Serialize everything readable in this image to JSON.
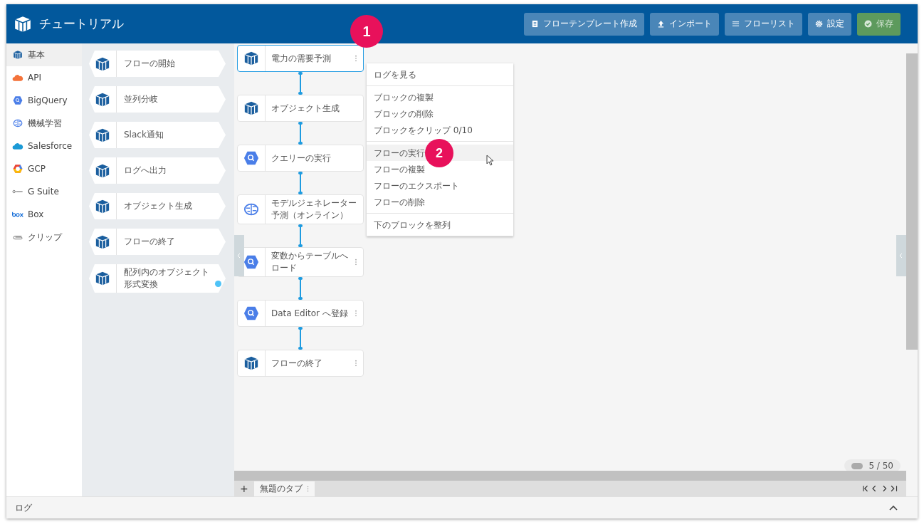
{
  "header": {
    "title": "チュートリアル",
    "buttons": [
      {
        "label": "フローテンプレート作成",
        "kind": "template"
      },
      {
        "label": "インポート",
        "kind": "import"
      },
      {
        "label": "フローリスト",
        "kind": "list"
      },
      {
        "label": "設定",
        "kind": "settings"
      },
      {
        "label": "保存",
        "kind": "save"
      }
    ]
  },
  "categories": [
    {
      "label": "基本",
      "kind": "logo",
      "selected": true
    },
    {
      "label": "API",
      "kind": "api",
      "selected": false
    },
    {
      "label": "BigQuery",
      "kind": "bigquery",
      "selected": false
    },
    {
      "label": "機械学習",
      "kind": "ml",
      "selected": false
    },
    {
      "label": "Salesforce",
      "kind": "cloud",
      "selected": false
    },
    {
      "label": "GCP",
      "kind": "gcp",
      "selected": false
    },
    {
      "label": "G Suite",
      "kind": "gsuite",
      "selected": false
    },
    {
      "label": "Box",
      "kind": "box",
      "selected": false
    },
    {
      "label": "クリップ",
      "kind": "clip",
      "selected": false
    }
  ],
  "palette": [
    {
      "label": "フローの開始",
      "kind": "logo",
      "note": false
    },
    {
      "label": "並列分岐",
      "kind": "logo",
      "note": false
    },
    {
      "label": "Slack通知",
      "kind": "logo",
      "note": false
    },
    {
      "label": "ログへ出力",
      "kind": "logo",
      "note": false
    },
    {
      "label": "オブジェクト生成",
      "kind": "logo",
      "note": false
    },
    {
      "label": "フローの終了",
      "kind": "logo",
      "note": false
    },
    {
      "label": "配列内のオブジェクト形式変換",
      "kind": "logo",
      "note": true
    }
  ],
  "flow": [
    {
      "label": "電力の需要予測",
      "kind": "logo",
      "selected": true,
      "menu_button": true
    },
    {
      "label": "オブジェクト生成",
      "kind": "logo",
      "selected": false,
      "menu_button": false
    },
    {
      "label": "クエリーの実行",
      "kind": "bigquery",
      "selected": false,
      "menu_button": false
    },
    {
      "label": "モデルジェネレーター予測（オンライン）",
      "kind": "ml",
      "selected": false,
      "menu_button": false
    },
    {
      "label": "変数からテーブルへロード",
      "kind": "bigquery",
      "selected": false,
      "menu_button": true
    },
    {
      "label": "Data Editor へ登録",
      "kind": "bigquery",
      "selected": false,
      "menu_button": true
    },
    {
      "label": "フローの終了",
      "kind": "logo",
      "selected": false,
      "menu_button": true
    }
  ],
  "menu": [
    [
      {
        "label": "ログを見る",
        "selected": false
      }
    ],
    [
      {
        "label": "ブロックの複製",
        "selected": false
      },
      {
        "label": "ブロックの削除",
        "selected": false
      },
      {
        "label": "ブロックをクリップ 0/10",
        "selected": false
      }
    ],
    [
      {
        "label": "フローの実行",
        "selected": true
      },
      {
        "label": "フローの複製",
        "selected": false
      },
      {
        "label": "フローのエクスポート",
        "selected": false
      },
      {
        "label": "フローの削除",
        "selected": false
      }
    ],
    [
      {
        "label": "下のブロックを整列",
        "selected": false
      }
    ]
  ],
  "callouts": [
    "1",
    "2"
  ],
  "tabs": {
    "add": "+",
    "items": [
      {
        "label": "無題のタブ"
      }
    ]
  },
  "counter": "5 / 50",
  "log_panel": {
    "title": "ログ"
  }
}
